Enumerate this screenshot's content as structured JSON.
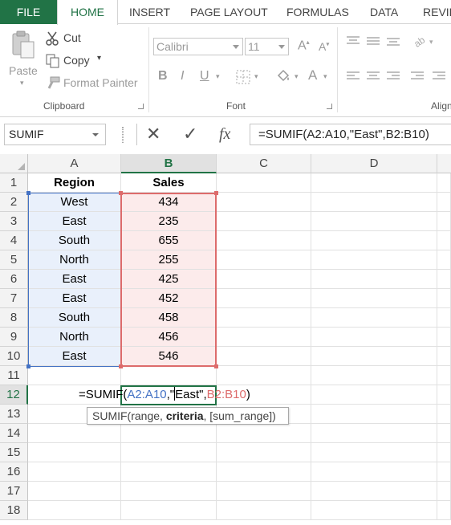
{
  "tabs": [
    "FILE",
    "HOME",
    "INSERT",
    "PAGE LAYOUT",
    "FORMULAS",
    "DATA",
    "REVIE"
  ],
  "ribbon": {
    "clipboard": {
      "paste": "Paste",
      "cut": "Cut",
      "copy": "Copy",
      "format_painter": "Format Painter",
      "label": "Clipboard"
    },
    "font": {
      "font_name": "Calibri",
      "font_size": "11",
      "bold": "B",
      "italic": "I",
      "underline": "U",
      "font_color_letter": "A",
      "grow_letter": "A",
      "shrink_letter": "A",
      "label": "Font"
    },
    "alignment": {
      "label": "Align"
    }
  },
  "formula_bar": {
    "name_box": "SUMIF",
    "cancel": "✕",
    "enter": "✓",
    "fx": "fx",
    "formula": "=SUMIF(A2:A10,\"East\",B2:B10)"
  },
  "grid": {
    "columns": [
      "A",
      "B",
      "C",
      "D"
    ],
    "rows": [
      "1",
      "2",
      "3",
      "4",
      "5",
      "6",
      "7",
      "8",
      "9",
      "10",
      "11",
      "12",
      "13",
      "14",
      "15",
      "16",
      "17",
      "18"
    ],
    "headers": [
      "Region",
      "Sales"
    ],
    "data": [
      [
        "West",
        "434"
      ],
      [
        "East",
        "235"
      ],
      [
        "South",
        "655"
      ],
      [
        "North",
        "255"
      ],
      [
        "East",
        "425"
      ],
      [
        "East",
        "452"
      ],
      [
        "South",
        "458"
      ],
      [
        "North",
        "456"
      ],
      [
        "East",
        "546"
      ]
    ],
    "editing": {
      "prefix": "=SUMIF(",
      "ref1": "A2:A10",
      "mid1": ",\"",
      "mid2": "East\",",
      "ref2": "B2:B10",
      "suffix": ")"
    },
    "tooltip": {
      "fn": "SUMIF(range, ",
      "bold": "criteria",
      "rest": ", [sum_range])"
    }
  },
  "colors": {
    "accent": "#217346",
    "range_blue": "#4472c4",
    "range_red": "#dd6b6b"
  }
}
